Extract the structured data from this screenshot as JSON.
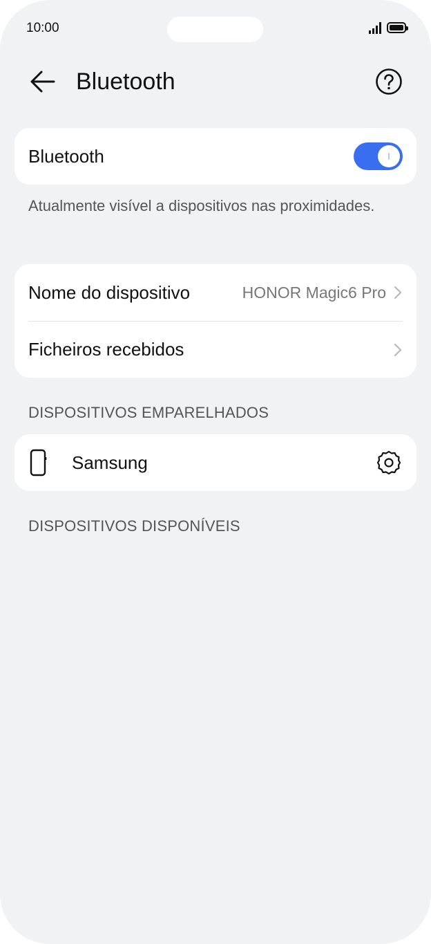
{
  "status_bar": {
    "time": "10:00"
  },
  "header": {
    "title": "Bluetooth",
    "back_icon": "back-arrow-icon",
    "help_icon": "help-circle-icon"
  },
  "bluetooth_card": {
    "label": "Bluetooth",
    "toggle_on": true,
    "accent_color": "#3a6ef0"
  },
  "visibility_hint": "Atualmente visível a dispositivos nas proximidades.",
  "settings_card": {
    "device_name_label": "Nome do dispositivo",
    "device_name_value": "HONOR Magic6 Pro",
    "received_files_label": "Ficheiros recebidos"
  },
  "paired_section": {
    "header": "DISPOSITIVOS EMPARELHADOS",
    "devices": [
      {
        "name": "Samsung",
        "icon": "phone-icon",
        "settings_icon": "gear-icon"
      }
    ]
  },
  "available_section": {
    "header": "DISPOSITIVOS DISPONÍVEIS"
  }
}
